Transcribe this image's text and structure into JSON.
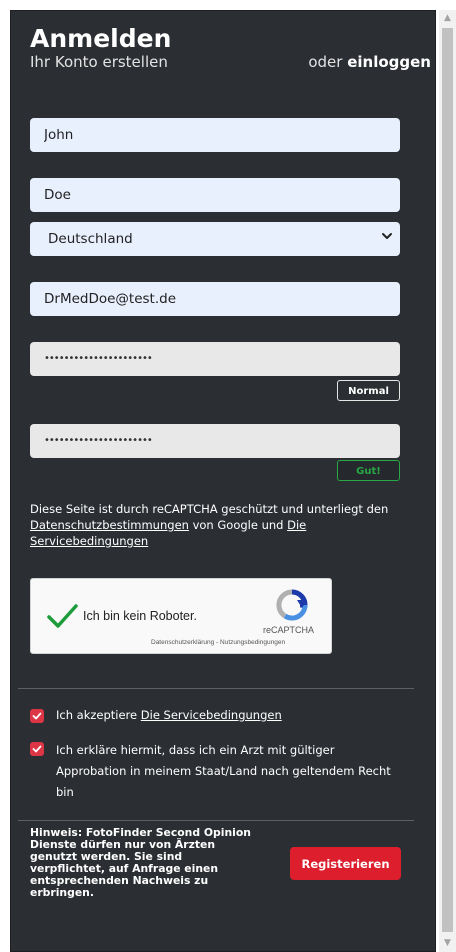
{
  "header": {
    "title": "Anmelden",
    "subtitle": "Ihr Konto erstellen",
    "or_text": "oder",
    "login_link": "einloggen"
  },
  "form": {
    "first_name": "John",
    "last_name": "Doe",
    "country": "Deutschland",
    "email": "DrMedDoe@test.de",
    "password_masked": "••••••••••••••••••••••",
    "password_strength": "Normal",
    "password_confirm_masked": "••••••••••••••••••••••",
    "confirm_strength": "Gut!"
  },
  "recaptcha_notice": {
    "prefix": "Diese Seite ist durch reCAPTCHA geschützt und unterliegt den",
    "privacy_link": "Datenschutzbestimmungen",
    "middle": " von Google und",
    "terms_link": "Die Servicebedingungen"
  },
  "captcha": {
    "label": "Ich bin kein Roboter.",
    "brand": "reCAPTCHA",
    "links": "Datenschutzerklärung - Nutzungsbedingungen",
    "checked": true
  },
  "checkboxes": [
    {
      "prefix": "Ich akzeptiere",
      "link": "Die Servicebedingungen",
      "checked": true
    },
    {
      "text": "Ich erkläre hiermit, dass ich ein Arzt mit gültiger Approbation in meinem Staat/Land nach geltendem Recht bin",
      "checked": true
    }
  ],
  "hint": "Hinweis: FotoFinder Second Opinion Dienste dürfen nur von Ärzten genutzt werden. Sie sind verpflichtet, auf Anfrage einen entsprechenden Nachweis zu erbringen.",
  "register_button": "Registerieren",
  "colors": {
    "card_bg": "#2b2e33",
    "input_bg": "#e8f0fe",
    "accent_red": "#dc1e2d",
    "success_green": "#28a745"
  }
}
